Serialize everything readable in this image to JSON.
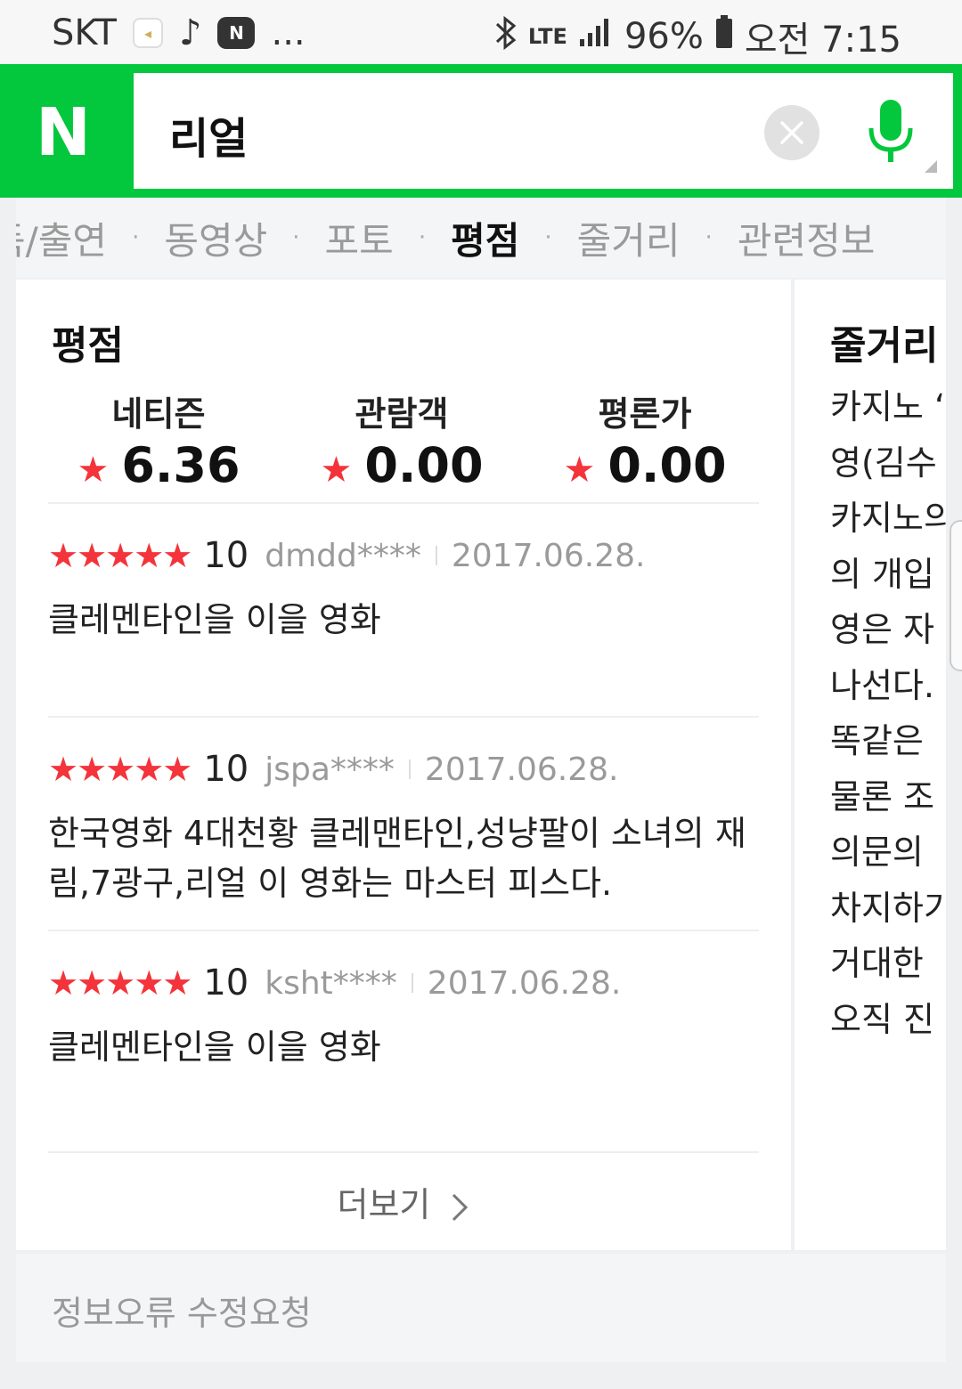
{
  "status_bar": {
    "carrier": "SKT",
    "more": "...",
    "network": "LTE",
    "battery": "96%",
    "time": "오전 7:15"
  },
  "search": {
    "logo": "N",
    "query": "리얼"
  },
  "tabs": [
    {
      "label": "득/출연",
      "active": false
    },
    {
      "label": "동영상",
      "active": false
    },
    {
      "label": "포토",
      "active": false
    },
    {
      "label": "평점",
      "active": true
    },
    {
      "label": "줄거리",
      "active": false
    },
    {
      "label": "관련정보",
      "active": false
    }
  ],
  "rating": {
    "title": "평점",
    "scores": [
      {
        "label": "네티즌",
        "value": "6.36"
      },
      {
        "label": "관람객",
        "value": "0.00"
      },
      {
        "label": "평론가",
        "value": "0.00"
      }
    ],
    "reviews": [
      {
        "stars": 5,
        "score": "10",
        "user": "dmdd****",
        "date": "2017.06.28.",
        "text": "클레멘타인을 이을 영화"
      },
      {
        "stars": 5,
        "score": "10",
        "user": "jspa****",
        "date": "2017.06.28.",
        "text": "한국영화 4대천황 클레맨타인,성냥팔이 소녀의 재림,7광구,리얼 이 영화는 마스터 피스다."
      },
      {
        "stars": 5,
        "score": "10",
        "user": "ksht****",
        "date": "2017.06.28.",
        "text": "클레멘타인을 이을 영화"
      }
    ],
    "more_label": "더보기"
  },
  "plot": {
    "title": "줄거리",
    "lines": [
      "카지노 ‘",
      "영(김수",
      "카지노의",
      "의 개입",
      "영은 자",
      "나선다.",
      "똑같은 ",
      "물론 조",
      "의문의 ",
      "차지하기",
      "거대한 ",
      "오직 진"
    ]
  },
  "footer": {
    "report_label": "정보오류 수정요청"
  },
  "colors": {
    "brand_green": "#03c73c",
    "star_red": "#f4333b"
  }
}
